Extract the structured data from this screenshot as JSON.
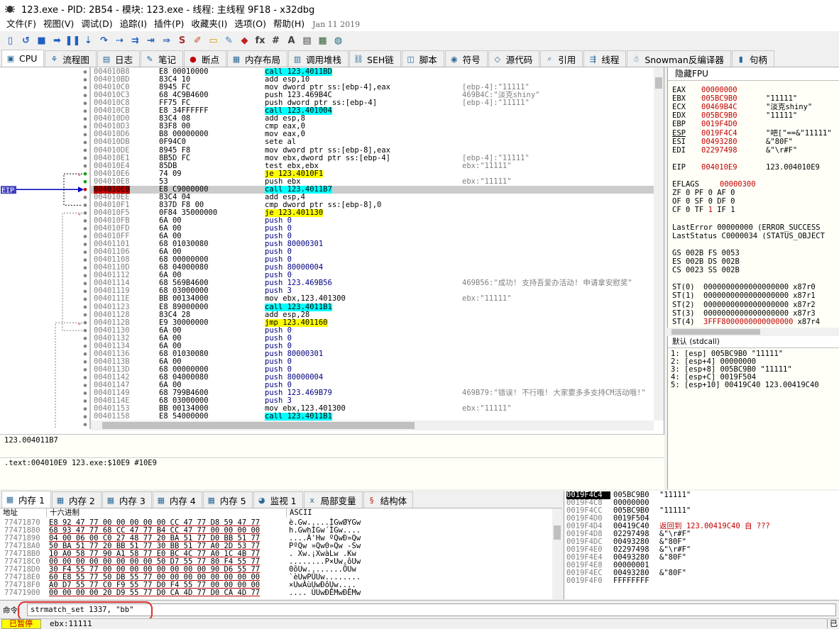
{
  "window": {
    "title": "123.exe - PID: 2B54 - 模块: 123.exe - 线程: 主线程 9F18 - x32dbg"
  },
  "menu": {
    "items": [
      "文件(F)",
      "视图(V)",
      "调试(D)",
      "追踪(I)",
      "插件(P)",
      "收藏夹(I)",
      "选项(O)",
      "帮助(H)"
    ],
    "date": "Jan 11 2019"
  },
  "toolbar": {
    "icons": [
      "open-icon",
      "restart-icon",
      "stop-icon",
      "run-icon",
      "pause-icon",
      "step-into-icon",
      "step-over-icon",
      "trace-into-icon",
      "trace-over-icon",
      "execute-till-return-icon",
      "run-to-user-code-icon",
      "scylla-icon",
      "patch-icon",
      "comment-icon",
      "label-icon",
      "bookmark-icon",
      "function-icon",
      "hash-icon",
      "font-icon",
      "strings-icon",
      "calculator-icon",
      "globe-icon"
    ]
  },
  "tabs": [
    {
      "label": "CPU",
      "icon": "cpu-icon",
      "active": true
    },
    {
      "label": "流程图",
      "icon": "graph-icon"
    },
    {
      "label": "日志",
      "icon": "log-icon"
    },
    {
      "label": "笔记",
      "icon": "notes-icon"
    },
    {
      "label": "断点",
      "icon": "breakpoint-icon"
    },
    {
      "label": "内存布局",
      "icon": "memory-map-icon"
    },
    {
      "label": "调用堆栈",
      "icon": "call-stack-icon"
    },
    {
      "label": "SEH链",
      "icon": "seh-icon"
    },
    {
      "label": "脚本",
      "icon": "script-icon"
    },
    {
      "label": "符号",
      "icon": "symbols-icon"
    },
    {
      "label": "源代码",
      "icon": "source-icon"
    },
    {
      "label": "引用",
      "icon": "references-icon"
    },
    {
      "label": "线程",
      "icon": "threads-icon"
    },
    {
      "label": "Snowman反编译器",
      "icon": "snowman-icon"
    },
    {
      "label": "句柄",
      "icon": "handles-icon"
    }
  ],
  "disasm": {
    "eip_label": "EIP",
    "rows": [
      {
        "addr": "004010B8",
        "bytes": "E8 00010000",
        "ins": "call 123.4011BD",
        "kind": "call"
      },
      {
        "addr": "004010BD",
        "bytes": "83C4 10",
        "ins": "add esp,10"
      },
      {
        "addr": "004010C0",
        "bytes": "8945 FC",
        "ins": "mov dword ptr ss:[ebp-4],eax",
        "cmt": "[ebp-4]:\"11111\""
      },
      {
        "addr": "004010C3",
        "bytes": "68 4C9B4600",
        "ins": "push 123.469B4C",
        "cmt": "469B4C:\"淡克shiny\""
      },
      {
        "addr": "004010C8",
        "bytes": "FF75 FC",
        "ins": "push dword ptr ss:[ebp-4]",
        "cmt": "[ebp-4]:\"11111\""
      },
      {
        "addr": "004010CB",
        "bytes": "E8 34FFFFFF",
        "ins": "call 123.401004",
        "kind": "call"
      },
      {
        "addr": "004010D0",
        "bytes": "83C4 08",
        "ins": "add esp,8"
      },
      {
        "addr": "004010D3",
        "bytes": "83F8 00",
        "ins": "cmp eax,0"
      },
      {
        "addr": "004010D6",
        "bytes": "B8 00000000",
        "ins": "mov eax,0"
      },
      {
        "addr": "004010DB",
        "bytes": "0F94C0",
        "ins": "sete al"
      },
      {
        "addr": "004010DE",
        "bytes": "8945 F8",
        "ins": "mov dword ptr ss:[ebp-8],eax"
      },
      {
        "addr": "004010E1",
        "bytes": "8B5D FC",
        "ins": "mov ebx,dword ptr ss:[ebp-4]",
        "cmt": "[ebp-4]:\"11111\""
      },
      {
        "addr": "004010E4",
        "bytes": "85DB",
        "ins": "test ebx,ebx",
        "cmt": "ebx:\"11111\""
      },
      {
        "addr": "004010E6",
        "bytes": "74 09",
        "ins": "je 123.4010F1",
        "kind": "jmp",
        "arrow": "v"
      },
      {
        "addr": "004010E8",
        "bytes": "53",
        "ins": "push ebx",
        "cmt": "ebx:\"11111\""
      },
      {
        "addr": "004010E9",
        "bytes": "E8 C9000000",
        "ins": "call 123.4011B7",
        "kind": "call",
        "hl": true
      },
      {
        "addr": "004010EE",
        "bytes": "83C4 04",
        "ins": "add esp,4"
      },
      {
        "addr": "004010F1",
        "bytes": "837D F8 00",
        "ins": "cmp dword ptr ss:[ebp-8],0"
      },
      {
        "addr": "004010F5",
        "bytes": "0F84 35000000",
        "ins": "je 123.401130",
        "kind": "jmp",
        "arrow": "v"
      },
      {
        "addr": "004010FB",
        "bytes": "6A 00",
        "ins": "push 0",
        "kind": "cpl"
      },
      {
        "addr": "004010FD",
        "bytes": "6A 00",
        "ins": "push 0",
        "kind": "cpl"
      },
      {
        "addr": "004010FF",
        "bytes": "6A 00",
        "ins": "push 0",
        "kind": "cpl"
      },
      {
        "addr": "00401101",
        "bytes": "68 01030080",
        "ins": "push 80000301",
        "kind": "cpl"
      },
      {
        "addr": "00401106",
        "bytes": "6A 00",
        "ins": "push 0",
        "kind": "cpl"
      },
      {
        "addr": "00401108",
        "bytes": "68 00000000",
        "ins": "push 0",
        "kind": "cpl"
      },
      {
        "addr": "0040110D",
        "bytes": "68 04000080",
        "ins": "push 80000004",
        "kind": "cpl"
      },
      {
        "addr": "00401112",
        "bytes": "6A 00",
        "ins": "push 0",
        "kind": "cpl"
      },
      {
        "addr": "00401114",
        "bytes": "68 569B4600",
        "ins": "push 123.469B56",
        "kind": "cpl",
        "cmt": "469B56:\"成功! 支持吾爱办活动! 申请拿安慰奖\""
      },
      {
        "addr": "00401119",
        "bytes": "68 03000000",
        "ins": "push 3",
        "kind": "cpl"
      },
      {
        "addr": "0040111E",
        "bytes": "BB 00134000",
        "ins": "mov ebx,123.401300",
        "cmt": "ebx:\"11111\""
      },
      {
        "addr": "00401123",
        "bytes": "E8 89000000",
        "ins": "call 123.4011B1",
        "kind": "call"
      },
      {
        "addr": "00401128",
        "bytes": "83C4 28",
        "ins": "add esp,28"
      },
      {
        "addr": "0040112B",
        "bytes": "E9 30000000",
        "ins": "jmp 123.401160",
        "kind": "jmp",
        "arrow": "v"
      },
      {
        "addr": "00401130",
        "bytes": "6A 00",
        "ins": "push 0",
        "kind": "cpl"
      },
      {
        "addr": "00401132",
        "bytes": "6A 00",
        "ins": "push 0",
        "kind": "cpl"
      },
      {
        "addr": "00401134",
        "bytes": "6A 00",
        "ins": "push 0",
        "kind": "cpl"
      },
      {
        "addr": "00401136",
        "bytes": "68 01030080",
        "ins": "push 80000301",
        "kind": "cpl"
      },
      {
        "addr": "0040113B",
        "bytes": "6A 00",
        "ins": "push 0",
        "kind": "cpl"
      },
      {
        "addr": "0040113D",
        "bytes": "68 00000000",
        "ins": "push 0",
        "kind": "cpl"
      },
      {
        "addr": "00401142",
        "bytes": "68 04000080",
        "ins": "push 80000004",
        "kind": "cpl"
      },
      {
        "addr": "00401147",
        "bytes": "6A 00",
        "ins": "push 0",
        "kind": "cpl"
      },
      {
        "addr": "00401149",
        "bytes": "68 799B4600",
        "ins": "push 123.469B79",
        "kind": "cpl",
        "cmt": "469B79:\"错误! 不行哦! 大家要多多支持CM活动哦!\""
      },
      {
        "addr": "0040114E",
        "bytes": "68 03000000",
        "ins": "push 3",
        "kind": "cpl"
      },
      {
        "addr": "00401153",
        "bytes": "BB 00134000",
        "ins": "mov ebx,123.401300",
        "cmt": "ebx:\"11111\""
      },
      {
        "addr": "00401158",
        "bytes": "E8 54000000",
        "ins": "call 123.4011B1",
        "kind": "call"
      },
      {
        "addr": "0040115D",
        "bytes": "83C4 28",
        "ins": "add esp,28"
      }
    ]
  },
  "info": {
    "line1": "123.004011B7",
    "line2": ".text:004010E9 123.exe:$10E9 #10E9"
  },
  "registers": {
    "header": "隐藏FPU",
    "gp": [
      {
        "n": "EAX",
        "v": "00000000",
        "c": ""
      },
      {
        "n": "EBX",
        "v": "005BC9B0",
        "c": "\"11111\""
      },
      {
        "n": "ECX",
        "v": "00469B4C",
        "c": "\"淡克shiny\""
      },
      {
        "n": "EDX",
        "v": "005BC9B0",
        "c": "\"11111\""
      },
      {
        "n": "EBP",
        "v": "0019F4D0",
        "c": ""
      },
      {
        "n": "ESP",
        "v": "0019F4C4",
        "c": "\"吧[\"==&\"11111\""
      },
      {
        "n": "ESI",
        "v": "00493280",
        "c": "&\"80F\""
      },
      {
        "n": "EDI",
        "v": "02297498",
        "c": "&\"\\r#F\""
      }
    ],
    "eip": {
      "n": "EIP",
      "v": "004010E9",
      "c": "123.004010E9"
    },
    "eflags": {
      "n": "EFLAGS",
      "v": "00000300"
    },
    "flags": [
      "ZF 0  PF 0  AF 0",
      "OF 0  SF 0  DF 0",
      "CF 0  TF 1  IF 1"
    ],
    "last_error": "LastError  00000000 (ERROR_SUCCESS",
    "last_status": "LastStatus C0000034 (STATUS_OBJECT",
    "segs": [
      "GS 002B  FS 0053",
      "ES 002B  DS 002B",
      "CS 0023  SS 002B"
    ],
    "fpu": [
      {
        "n": "ST(0)",
        "v": "0000000000000000000",
        "t": "x87r0"
      },
      {
        "n": "ST(1)",
        "v": "0000000000000000000",
        "t": "x87r1"
      },
      {
        "n": "ST(2)",
        "v": "0000000000000000000",
        "t": "x87r2"
      },
      {
        "n": "ST(3)",
        "v": "0000000000000000000",
        "t": "x87r3"
      },
      {
        "n": "ST(4)",
        "v": "3FFF8000000000000000",
        "t": "x87r4"
      }
    ]
  },
  "callconv": {
    "header": "默认 (stdcall)",
    "args": [
      "1: [esp] 005BC9B0 \"11111\"",
      "2: [esp+4] 00000000",
      "3: [esp+8] 005BC9B0 \"11111\"",
      "4: [esp+C] 0019F504",
      "5: [esp+10] 00419C40 123.00419C40"
    ]
  },
  "memtabs": [
    {
      "label": "内存 1",
      "icon": "memory-icon",
      "active": true
    },
    {
      "label": "内存 2",
      "icon": "memory-icon"
    },
    {
      "label": "内存 3",
      "icon": "memory-icon"
    },
    {
      "label": "内存 4",
      "icon": "memory-icon"
    },
    {
      "label": "内存 5",
      "icon": "memory-icon"
    },
    {
      "label": "监视 1",
      "icon": "watch-icon"
    },
    {
      "label": "局部变量",
      "icon": "locals-icon"
    },
    {
      "label": "结构体",
      "icon": "struct-icon"
    }
  ],
  "dump": {
    "headers": [
      "地址",
      "十六进制",
      "ASCII"
    ],
    "rows": [
      {
        "a": "77471870",
        "h": "E8 92 47 77  00 00 00 00  00 CC 47 77  D8 59 47 77",
        "s": "è.Gw.....ÌGwØYGw"
      },
      {
        "a": "77471880",
        "h": "68 93 47 77  68 CC 47 77  B4 CC 47 77  00 00 00 00",
        "s": "h.GwhÌGw´ÌGw...."
      },
      {
        "a": "77471890",
        "h": "04 00 06 00  C0 27 48 77  20 BA 51 77  D0 BB 51 77",
        "s": "....À'Hw ºQwÐ»Qw"
      },
      {
        "a": "774718A0",
        "h": "50 BA 51 77  20 BB 51 77  30 BB 51 77  A0 2D 53 77",
        "s": "PºQw »Qw0»Qw -Sw"
      },
      {
        "a": "774718B0",
        "h": "10 A0 58 77  90 A1 58 77  E0 BC 4C 77  A0 1C 4B 77",
        "s": ". Xw.¡XwàLw .Kw"
      },
      {
        "a": "774718C0",
        "h": "00 00 00 00  00 00 00 00  50 D7 55 77  80 F4 55 77",
        "s": "........P×Uw.ôUw"
      },
      {
        "a": "774718D0",
        "h": "30 F4 55 77  00 00 00 00  00 00 00 00  90 D6 55 77",
        "s": "0ôUw........ÖUw"
      },
      {
        "a": "774718E0",
        "h": "60 E8 55 77  50 DB 55 77  00 00 00 00  00 00 00 00",
        "s": "`èUwPÛUw........"
      },
      {
        "a": "774718F0",
        "h": "A0 D7 55 77  C0 F9 55 77  D0 F4 55 77  00 00 00 00",
        "s": " ×UwÀùUwÐôUw...."
      },
      {
        "a": "77471900",
        "h": "00 00 00 00  20 D9 55 77  D0 CA 4D 77  D0 CA 4D 77",
        "s": ".... ÙUwÐÊMwÐÊMw"
      }
    ]
  },
  "stack": [
    {
      "a": "0019F4C4",
      "v": "005BC9B0",
      "c": "\"11111\"",
      "top": true
    },
    {
      "a": "0019F4C8",
      "v": "00000000",
      "c": ""
    },
    {
      "a": "0019F4CC",
      "v": "005BC9B0",
      "c": "\"11111\""
    },
    {
      "a": "0019F4D0",
      "v": "0019F504",
      "c": ""
    },
    {
      "a": "0019F4D4",
      "v": "00419C40",
      "c": "返回到 123.00419C40 自 ???",
      "red": true
    },
    {
      "a": "0019F4D8",
      "v": "02297498",
      "c": "&\"\\r#F\""
    },
    {
      "a": "0019F4DC",
      "v": "00493280",
      "c": "&\"80F\""
    },
    {
      "a": "0019F4E0",
      "v": "02297498",
      "c": "&\"\\r#F\""
    },
    {
      "a": "0019F4E4",
      "v": "00493280",
      "c": "&\"80F\""
    },
    {
      "a": "0019F4E8",
      "v": "00000001",
      "c": ""
    },
    {
      "a": "0019F4EC",
      "v": "00493280",
      "c": "&\"80F\""
    },
    {
      "a": "0019F4F0",
      "v": "FFFFFFFF",
      "c": ""
    }
  ],
  "cmd": {
    "label": "命令:",
    "value": "strmatch_set 1337, \"bb\""
  },
  "status": {
    "state": "已暂停",
    "message": "ebx:11111",
    "right": "已"
  }
}
